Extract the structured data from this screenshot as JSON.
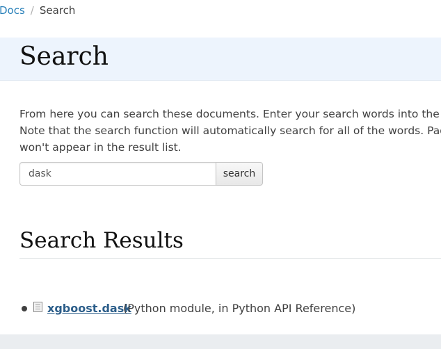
{
  "breadcrumb": {
    "home": "Docs",
    "separator": "/",
    "current": "Search"
  },
  "page": {
    "title": "Search"
  },
  "intro": {
    "line1": "From here you can search these documents. Enter your search words into the box",
    "line2": "Note that the search function will automatically search for all of the words. Pages",
    "line3": "won't appear in the result list."
  },
  "search": {
    "value": "dask",
    "button_label": "search"
  },
  "results": {
    "heading": "Search Results",
    "items": [
      {
        "link_text": "xgboost.dask",
        "context": "(Python module, in Python API Reference)",
        "icon": "file-icon"
      }
    ]
  },
  "colors": {
    "link": "#2980b9",
    "result_link": "#2c5e8a",
    "title_band": "#edf4fd",
    "text": "#404040"
  }
}
